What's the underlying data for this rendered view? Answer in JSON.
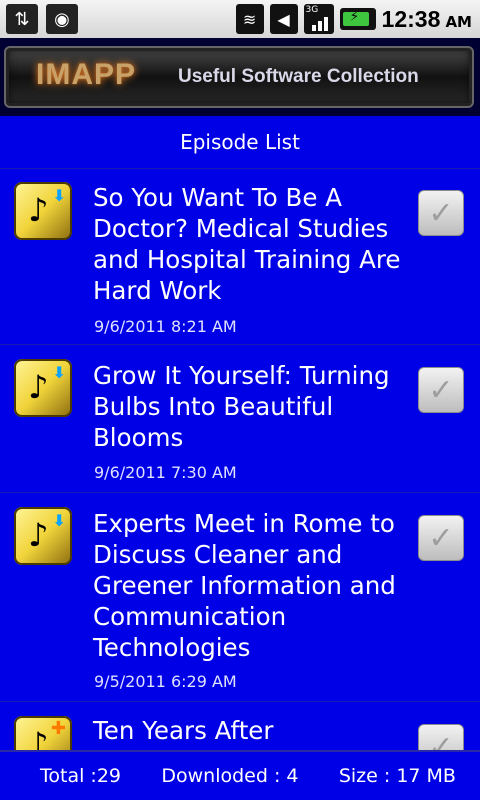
{
  "statusbar": {
    "time": "12:38",
    "ampm": "AM",
    "network": "3G"
  },
  "banner": {
    "brand": "IMAPP",
    "tagline": "Useful Software Collection"
  },
  "list": {
    "title": "Episode List",
    "episodes": [
      {
        "title": "So You Want To Be A Doctor? Medical Studies and Hospital Training Are Hard Work",
        "date": "9/6/2011 8:21 AM"
      },
      {
        "title": "Grow It Yourself: Turning Bulbs Into Beautiful Blooms",
        "date": "9/6/2011 7:30 AM"
      },
      {
        "title": "Experts Meet in Rome to Discuss Cleaner and Greener Information and Communication Technologies",
        "date": "9/5/2011 6:29 AM"
      },
      {
        "title": "Ten Years After",
        "date": ""
      }
    ]
  },
  "footer": {
    "total": "Total :29",
    "downloaded": "Downloded : 4",
    "size": "Size : 17 MB"
  },
  "colors": {
    "background": "#0000e6",
    "accent": "#f1d43a"
  }
}
